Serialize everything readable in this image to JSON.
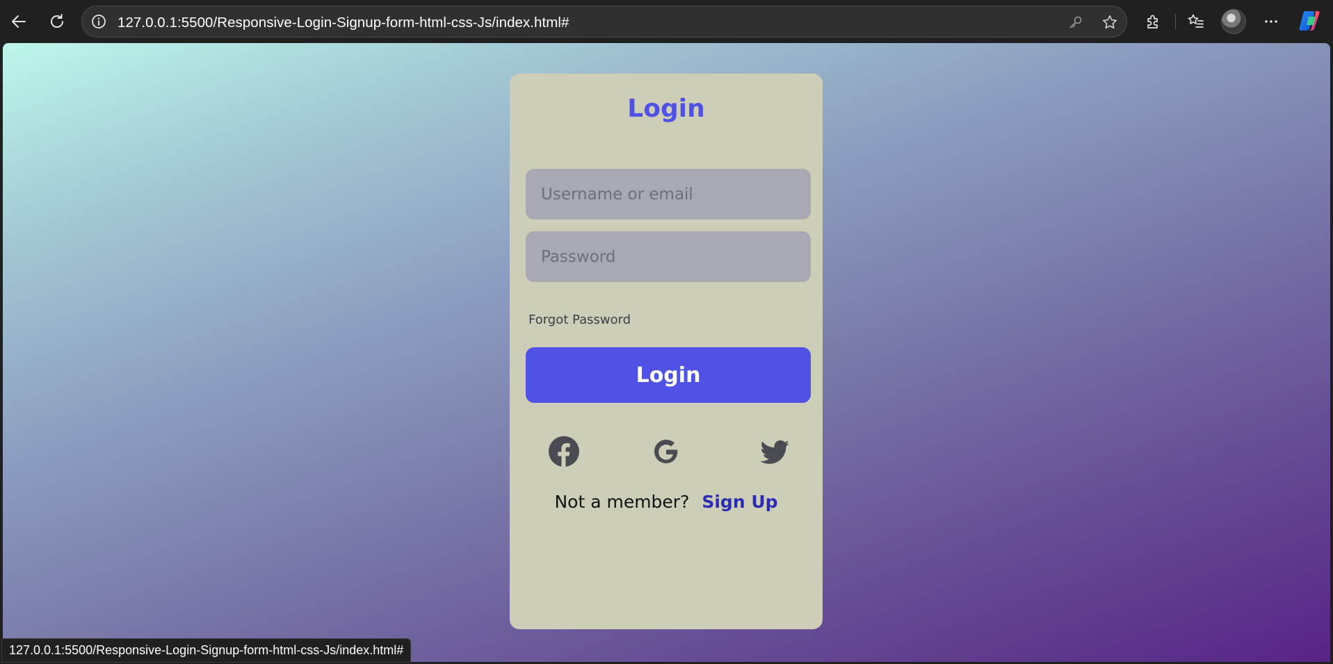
{
  "browser": {
    "url": "127.0.0.1:5500/Responsive-Login-Signup-form-html-css-Js/index.html#",
    "icons": [
      "back-arrow-icon",
      "reload-icon",
      "site-info-icon",
      "key-icon",
      "star-icon",
      "extensions-icon",
      "favorites-icon",
      "profile-avatar",
      "more-options-icon",
      "copilot-icon"
    ]
  },
  "login_form": {
    "title": "Login",
    "username_placeholder": "Username or email",
    "password_placeholder": "Password",
    "forgot_password": "Forgot Password",
    "submit_label": "Login",
    "social_icons": [
      "facebook-icon",
      "google-icon",
      "twitter-icon"
    ],
    "not_member_text": "Not a member?",
    "signup_link": "Sign Up"
  },
  "status_bar": {
    "link_url": "127.0.0.1:5500/Responsive-Login-Signup-form-html-css-Js/index.html#"
  },
  "colors": {
    "accent": "#5052e6",
    "card_background": "#cdcdb8",
    "input_background": "#a8a9b3",
    "signup_link": "#2a2cb3",
    "gradient_start": "#bdf6ea",
    "gradient_end": "#582486"
  }
}
